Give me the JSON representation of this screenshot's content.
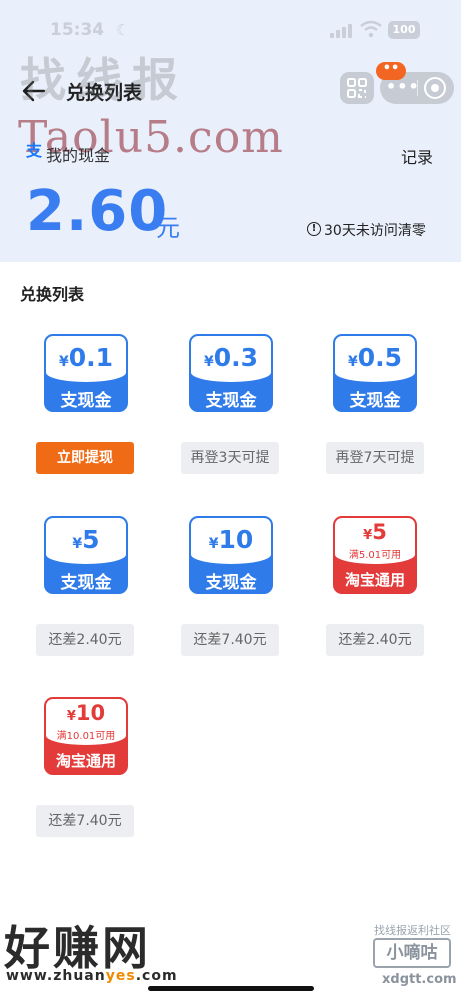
{
  "status_bar": {
    "time": "15:34",
    "battery": "100"
  },
  "header": {
    "title": "兑换列表",
    "notify_badge": "••"
  },
  "watermark": {
    "top_cn": "找线报",
    "top_en": "Taolu5.com",
    "bottom_cn": "好赚网",
    "bottom_url_parts": [
      "www.zhuan",
      "yes",
      ".com"
    ],
    "bottom_right_top": "找线报返利社区",
    "bottom_right_box": "小嘀咕",
    "bottom_right_url": "xdgtt.com"
  },
  "cash": {
    "label": "我的现金",
    "amount": "2.60",
    "unit": "元",
    "record": "记录",
    "expire_note": "30天未访问清零"
  },
  "section_title": "兑换列表",
  "colors": {
    "accent_blue": "#2f7bea",
    "accent_red": "#e33a3a",
    "cta_orange": "#f06b16"
  },
  "icons": [
    "back-arrow-icon",
    "qr-scan-icon",
    "more-icon",
    "close-target-icon",
    "zhifubao-icon",
    "info-icon"
  ],
  "exchange_items": [
    {
      "currency": "¥",
      "amount": "0.1",
      "condition": "",
      "name": "支现金",
      "style": "blue",
      "action": "立即提现",
      "action_primary": true
    },
    {
      "currency": "¥",
      "amount": "0.3",
      "condition": "",
      "name": "支现金",
      "style": "blue",
      "action": "再登3天可提",
      "action_primary": false
    },
    {
      "currency": "¥",
      "amount": "0.5",
      "condition": "",
      "name": "支现金",
      "style": "blue",
      "action": "再登7天可提",
      "action_primary": false
    },
    {
      "currency": "¥",
      "amount": "5",
      "condition": "",
      "name": "支现金",
      "style": "blue",
      "action": "还差2.40元",
      "action_primary": false
    },
    {
      "currency": "¥",
      "amount": "10",
      "condition": "",
      "name": "支现金",
      "style": "blue",
      "action": "还差7.40元",
      "action_primary": false
    },
    {
      "currency": "¥",
      "amount": "5",
      "condition": "满5.01可用",
      "name": "淘宝通用",
      "style": "red",
      "action": "还差2.40元",
      "action_primary": false
    },
    {
      "currency": "¥",
      "amount": "10",
      "condition": "满10.01可用",
      "name": "淘宝通用",
      "style": "red",
      "action": "还差7.40元",
      "action_primary": false
    }
  ]
}
